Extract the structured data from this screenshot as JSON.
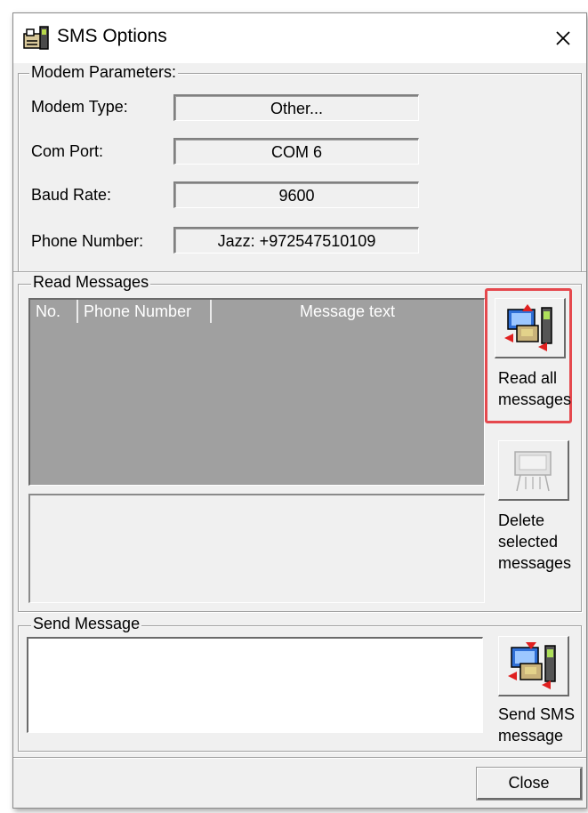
{
  "window": {
    "title": "SMS Options"
  },
  "modem": {
    "legend": "Modem Parameters:",
    "rows": [
      {
        "label": "Modem Type:",
        "value": "Other..."
      },
      {
        "label": "Com Port:",
        "value": "COM 6"
      },
      {
        "label": "Baud Rate:",
        "value": "9600"
      },
      {
        "label": "Phone Number:",
        "value": "Jazz: +972547510109"
      }
    ]
  },
  "read": {
    "legend": "Read Messages",
    "columns": [
      "No.",
      "Phone Number",
      "Message text"
    ],
    "read_all_label": "Read all\nmessages",
    "delete_label": "Delete\nselected\nmessages"
  },
  "send": {
    "legend": "Send Message",
    "send_label": "Send SMS\nmessage"
  },
  "footer": {
    "close_label": "Close"
  },
  "colors": {
    "highlight": "#e5484d",
    "listview_bg": "#a0a0a0"
  },
  "icons": {
    "app": "sms-app-icon",
    "close": "close-icon",
    "read": "read-messages-icon",
    "delete": "delete-messages-icon",
    "send": "send-sms-icon"
  }
}
